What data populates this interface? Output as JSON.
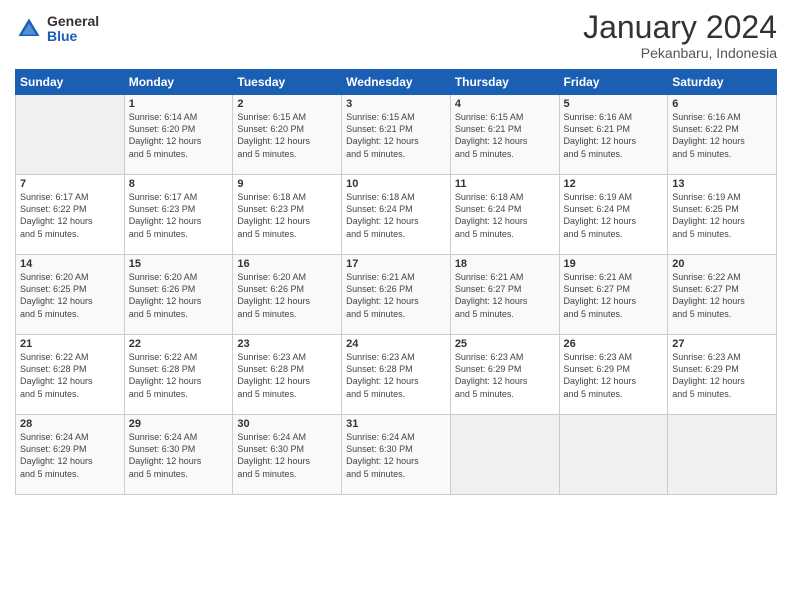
{
  "logo": {
    "general": "General",
    "blue": "Blue"
  },
  "title": "January 2024",
  "location": "Pekanbaru, Indonesia",
  "days_header": [
    "Sunday",
    "Monday",
    "Tuesday",
    "Wednesday",
    "Thursday",
    "Friday",
    "Saturday"
  ],
  "weeks": [
    [
      {
        "day": "",
        "info": ""
      },
      {
        "day": "1",
        "info": "Sunrise: 6:14 AM\nSunset: 6:20 PM\nDaylight: 12 hours\nand 5 minutes."
      },
      {
        "day": "2",
        "info": "Sunrise: 6:15 AM\nSunset: 6:20 PM\nDaylight: 12 hours\nand 5 minutes."
      },
      {
        "day": "3",
        "info": "Sunrise: 6:15 AM\nSunset: 6:21 PM\nDaylight: 12 hours\nand 5 minutes."
      },
      {
        "day": "4",
        "info": "Sunrise: 6:15 AM\nSunset: 6:21 PM\nDaylight: 12 hours\nand 5 minutes."
      },
      {
        "day": "5",
        "info": "Sunrise: 6:16 AM\nSunset: 6:21 PM\nDaylight: 12 hours\nand 5 minutes."
      },
      {
        "day": "6",
        "info": "Sunrise: 6:16 AM\nSunset: 6:22 PM\nDaylight: 12 hours\nand 5 minutes."
      }
    ],
    [
      {
        "day": "7",
        "info": "Sunrise: 6:17 AM\nSunset: 6:22 PM\nDaylight: 12 hours\nand 5 minutes."
      },
      {
        "day": "8",
        "info": "Sunrise: 6:17 AM\nSunset: 6:23 PM\nDaylight: 12 hours\nand 5 minutes."
      },
      {
        "day": "9",
        "info": "Sunrise: 6:18 AM\nSunset: 6:23 PM\nDaylight: 12 hours\nand 5 minutes."
      },
      {
        "day": "10",
        "info": "Sunrise: 6:18 AM\nSunset: 6:24 PM\nDaylight: 12 hours\nand 5 minutes."
      },
      {
        "day": "11",
        "info": "Sunrise: 6:18 AM\nSunset: 6:24 PM\nDaylight: 12 hours\nand 5 minutes."
      },
      {
        "day": "12",
        "info": "Sunrise: 6:19 AM\nSunset: 6:24 PM\nDaylight: 12 hours\nand 5 minutes."
      },
      {
        "day": "13",
        "info": "Sunrise: 6:19 AM\nSunset: 6:25 PM\nDaylight: 12 hours\nand 5 minutes."
      }
    ],
    [
      {
        "day": "14",
        "info": "Sunrise: 6:20 AM\nSunset: 6:25 PM\nDaylight: 12 hours\nand 5 minutes."
      },
      {
        "day": "15",
        "info": "Sunrise: 6:20 AM\nSunset: 6:26 PM\nDaylight: 12 hours\nand 5 minutes."
      },
      {
        "day": "16",
        "info": "Sunrise: 6:20 AM\nSunset: 6:26 PM\nDaylight: 12 hours\nand 5 minutes."
      },
      {
        "day": "17",
        "info": "Sunrise: 6:21 AM\nSunset: 6:26 PM\nDaylight: 12 hours\nand 5 minutes."
      },
      {
        "day": "18",
        "info": "Sunrise: 6:21 AM\nSunset: 6:27 PM\nDaylight: 12 hours\nand 5 minutes."
      },
      {
        "day": "19",
        "info": "Sunrise: 6:21 AM\nSunset: 6:27 PM\nDaylight: 12 hours\nand 5 minutes."
      },
      {
        "day": "20",
        "info": "Sunrise: 6:22 AM\nSunset: 6:27 PM\nDaylight: 12 hours\nand 5 minutes."
      }
    ],
    [
      {
        "day": "21",
        "info": "Sunrise: 6:22 AM\nSunset: 6:28 PM\nDaylight: 12 hours\nand 5 minutes."
      },
      {
        "day": "22",
        "info": "Sunrise: 6:22 AM\nSunset: 6:28 PM\nDaylight: 12 hours\nand 5 minutes."
      },
      {
        "day": "23",
        "info": "Sunrise: 6:23 AM\nSunset: 6:28 PM\nDaylight: 12 hours\nand 5 minutes."
      },
      {
        "day": "24",
        "info": "Sunrise: 6:23 AM\nSunset: 6:28 PM\nDaylight: 12 hours\nand 5 minutes."
      },
      {
        "day": "25",
        "info": "Sunrise: 6:23 AM\nSunset: 6:29 PM\nDaylight: 12 hours\nand 5 minutes."
      },
      {
        "day": "26",
        "info": "Sunrise: 6:23 AM\nSunset: 6:29 PM\nDaylight: 12 hours\nand 5 minutes."
      },
      {
        "day": "27",
        "info": "Sunrise: 6:23 AM\nSunset: 6:29 PM\nDaylight: 12 hours\nand 5 minutes."
      }
    ],
    [
      {
        "day": "28",
        "info": "Sunrise: 6:24 AM\nSunset: 6:29 PM\nDaylight: 12 hours\nand 5 minutes."
      },
      {
        "day": "29",
        "info": "Sunrise: 6:24 AM\nSunset: 6:30 PM\nDaylight: 12 hours\nand 5 minutes."
      },
      {
        "day": "30",
        "info": "Sunrise: 6:24 AM\nSunset: 6:30 PM\nDaylight: 12 hours\nand 5 minutes."
      },
      {
        "day": "31",
        "info": "Sunrise: 6:24 AM\nSunset: 6:30 PM\nDaylight: 12 hours\nand 5 minutes."
      },
      {
        "day": "",
        "info": ""
      },
      {
        "day": "",
        "info": ""
      },
      {
        "day": "",
        "info": ""
      }
    ]
  ]
}
